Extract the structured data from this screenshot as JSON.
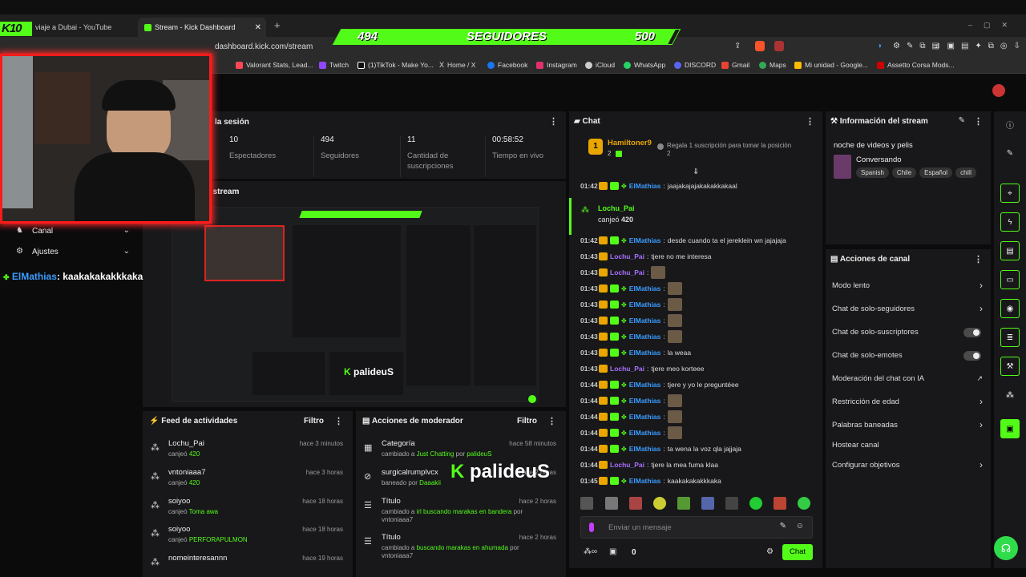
{
  "tabs": [
    {
      "label": "viaje a Dubai - YouTube"
    },
    {
      "label": "Stream - Kick Dashboard"
    }
  ],
  "address": "dashboard.kick.com/stream",
  "bookmarks": [
    "Valorant Stats, Lead...",
    "Twitch",
    "(1)TikTok - Make Yo...",
    "Home / X",
    "Facebook",
    "Instagram",
    "iCloud",
    "WhatsApp",
    "DISCORD",
    "Gmail",
    "Maps",
    "Mi unidad - Google...",
    "Assetto Corsa Mods..."
  ],
  "overlay": {
    "logo": "K10",
    "followers_current": "494",
    "followers_label": "SEGUIDORES",
    "followers_goal": "500",
    "followers_progress": 0.988,
    "chat_ticker_user": "ElMathias",
    "chat_ticker_text": ": kaakakakakkkaka"
  },
  "session": {
    "title": "la sesión",
    "stats": [
      {
        "value": "10",
        "label": "Espectadores"
      },
      {
        "value": "494",
        "label": "Seguidores"
      },
      {
        "value": "11",
        "label": "Cantidad de suscripciones"
      },
      {
        "value": "00:58:52",
        "label": "Tiempo en vivo"
      }
    ]
  },
  "preview": {
    "title": "l stream"
  },
  "left_menu": [
    {
      "label": "Canal"
    },
    {
      "label": "Ajustes"
    }
  ],
  "activity_feed": {
    "title": "Feed de actividades",
    "filter": "Filtro",
    "items": [
      {
        "name": "Lochu_Pai",
        "action": "canjeó",
        "value": "420",
        "time": "hace 3 minutos"
      },
      {
        "name": "vntoniaaa7",
        "action": "canjeó",
        "value": "420",
        "time": "hace 3 horas"
      },
      {
        "name": "soiyoo",
        "action": "canjeó",
        "value": "Toma awa",
        "time": "hace 18 horas"
      },
      {
        "name": "soiyoo",
        "action": "canjeó",
        "value": "PERFORAPULMON",
        "time": "hace 18 horas"
      },
      {
        "name": "nomeinteresannn",
        "action": "",
        "value": "",
        "time": "hace 19 horas"
      }
    ]
  },
  "mod_actions": {
    "title": "Acciones de moderador",
    "filter": "Filtro",
    "items": [
      {
        "name": "Categoría",
        "sub_pre": "cambiado a",
        "sub_val": "Just Chatting",
        "sub_post": "por",
        "by": "palideuS",
        "time": "hace 58 minutos"
      },
      {
        "name": "surgicalrumplvcx",
        "sub_pre": "baneado por",
        "sub_val": "",
        "sub_post": "",
        "by": "Daaakii",
        "time": "hace 2 horas"
      },
      {
        "name": "Título",
        "sub_pre": "cambiado a",
        "sub_val": "irl buscando marakas en bandera",
        "sub_post": "por",
        "by": "vntoniaaa7",
        "time": "hace 2 horas"
      },
      {
        "name": "Título",
        "sub_pre": "cambiado a",
        "sub_val": "buscando marakas en ahumada",
        "sub_post": "por",
        "by": "vntoniaaa7",
        "time": "hace 2 horas"
      }
    ],
    "watermark": "palideuS"
  },
  "chat": {
    "title": "Chat",
    "top_user": "Hamiltoner9",
    "top_rank": "1",
    "top_count": "2",
    "gift_text": "Regala 1 suscripción para tomar la posición",
    "gift_count": "2",
    "redeem_user": "Lochu_Pai",
    "redeem_text": "canjeó",
    "redeem_value": "420",
    "messages": [
      {
        "time": "01:42",
        "user": "ElMathias",
        "color": "#3b9cff",
        "badges": 3,
        "text": "jaajakajajakakakkakaal"
      },
      {
        "time": "01:42",
        "user": "ElMathias",
        "color": "#3b9cff",
        "badges": 3,
        "text": "desde cuando ta el jereklein wn jajajaja"
      },
      {
        "time": "01:43",
        "user": "Lochu_Pai",
        "color": "#a970ff",
        "badges": 1,
        "text": "tjere no me interesa"
      },
      {
        "time": "01:43",
        "user": "Lochu_Pai",
        "color": "#a970ff",
        "badges": 1,
        "text": "",
        "emote": true
      },
      {
        "time": "01:43",
        "user": "ElMathias",
        "color": "#3b9cff",
        "badges": 3,
        "text": "",
        "emote": true
      },
      {
        "time": "01:43",
        "user": "ElMathias",
        "color": "#3b9cff",
        "badges": 3,
        "text": "",
        "emote": true
      },
      {
        "time": "01:43",
        "user": "ElMathias",
        "color": "#3b9cff",
        "badges": 3,
        "text": "",
        "emote": true
      },
      {
        "time": "01:43",
        "user": "ElMathias",
        "color": "#3b9cff",
        "badges": 3,
        "text": "",
        "emote": true
      },
      {
        "time": "01:43",
        "user": "ElMathias",
        "color": "#3b9cff",
        "badges": 3,
        "text": "la weaa"
      },
      {
        "time": "01:43",
        "user": "Lochu_Pai",
        "color": "#a970ff",
        "badges": 1,
        "text": "tjere meo korteee"
      },
      {
        "time": "01:44",
        "user": "ElMathias",
        "color": "#3b9cff",
        "badges": 3,
        "text": "tjere y yo le preguntéee"
      },
      {
        "time": "01:44",
        "user": "ElMathias",
        "color": "#3b9cff",
        "badges": 3,
        "text": "",
        "emote": true
      },
      {
        "time": "01:44",
        "user": "ElMathias",
        "color": "#3b9cff",
        "badges": 3,
        "text": "",
        "emote": true
      },
      {
        "time": "01:44",
        "user": "ElMathias",
        "color": "#3b9cff",
        "badges": 3,
        "text": "",
        "emote": true
      },
      {
        "time": "01:44",
        "user": "ElMathias",
        "color": "#3b9cff",
        "badges": 3,
        "text": "ta wena la voz qla jajjaja"
      },
      {
        "time": "01:44",
        "user": "Lochu_Pai",
        "color": "#a970ff",
        "badges": 1,
        "text": "tjere la mea fuma klaa"
      },
      {
        "time": "01:45",
        "user": "ElMathias",
        "color": "#3b9cff",
        "badges": 3,
        "text": "kaakakakakkkaka"
      }
    ],
    "input_placeholder": "Enviar un mensaje",
    "points": "0",
    "send_label": "Chat"
  },
  "stream_info": {
    "title": "Información del stream",
    "stream_title": "noche de videos y pelis",
    "category": "Conversando",
    "tags": [
      "Spanish",
      "Chile",
      "Español",
      "chill"
    ]
  },
  "channel_actions": {
    "title": "Acciones de canal",
    "items": [
      {
        "label": "Modo lento",
        "type": "chevron"
      },
      {
        "label": "Chat de solo-seguidores",
        "type": "chevron"
      },
      {
        "label": "Chat de solo-suscriptores",
        "type": "toggle"
      },
      {
        "label": "Chat de solo-emotes",
        "type": "toggle"
      },
      {
        "label": "Moderación del chat con IA",
        "type": "external"
      },
      {
        "label": "Restricción de edad",
        "type": "chevron"
      },
      {
        "label": "Palabras baneadas",
        "type": "chevron"
      },
      {
        "label": "Hostear canal",
        "type": "none"
      },
      {
        "label": "Configurar objetivos",
        "type": "chevron"
      }
    ]
  },
  "colors": {
    "kick_green": "#53fc18",
    "panel_bg": "#18181a",
    "overlay_red": "#ff1a1a"
  }
}
